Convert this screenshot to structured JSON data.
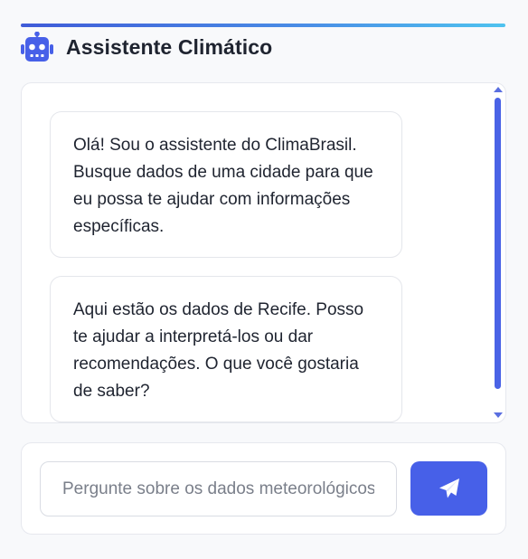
{
  "header": {
    "title": "Assistente Climático",
    "icon": "robot-icon"
  },
  "chat": {
    "messages": [
      {
        "sender": "assistant",
        "text": "Olá! Sou o assistente do ClimaBrasil. Busque dados de uma cidade para que eu possa te ajudar com informações específicas."
      },
      {
        "sender": "assistant",
        "text": "Aqui estão os dados de Recife. Posso te ajudar a interpretá-los ou dar recomendações. O que você gostaria de saber?"
      }
    ]
  },
  "input": {
    "placeholder": "Pergunte sobre os dados meteorológicos...",
    "value": "",
    "send_icon": "paper-plane-icon"
  },
  "colors": {
    "accent": "#4760e8",
    "gradient_end": "#4fc3ef",
    "text": "#1f2430"
  }
}
